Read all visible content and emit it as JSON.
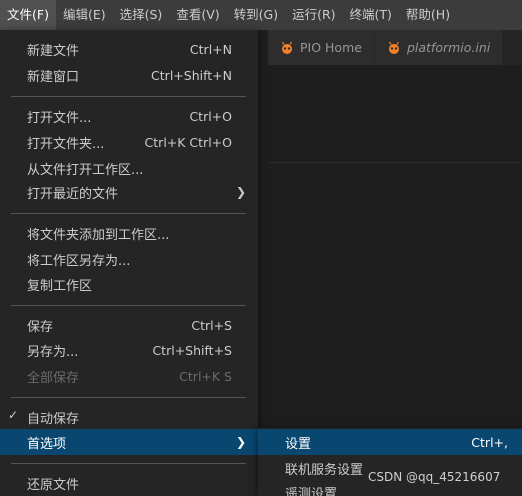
{
  "menubar": {
    "items": [
      "文件(F)",
      "编辑(E)",
      "选择(S)",
      "查看(V)",
      "转到(G)",
      "运行(R)",
      "终端(T)",
      "帮助(H)"
    ]
  },
  "tabs": [
    {
      "label": "PIO Home",
      "icon": "platformio-ant-icon"
    },
    {
      "label": "platformio.ini",
      "icon": "platformio-ant-icon"
    }
  ],
  "file_menu": {
    "new_file": {
      "label": "新建文件",
      "shortcut": "Ctrl+N"
    },
    "new_window": {
      "label": "新建窗口",
      "shortcut": "Ctrl+Shift+N"
    },
    "open_file": {
      "label": "打开文件...",
      "shortcut": "Ctrl+O"
    },
    "open_folder": {
      "label": "打开文件夹...",
      "shortcut": "Ctrl+K Ctrl+O"
    },
    "open_workspace": {
      "label": "从文件打开工作区..."
    },
    "open_recent": {
      "label": "打开最近的文件"
    },
    "add_folder": {
      "label": "将文件夹添加到工作区..."
    },
    "save_workspace_as": {
      "label": "将工作区另存为..."
    },
    "duplicate_workspace": {
      "label": "复制工作区"
    },
    "save": {
      "label": "保存",
      "shortcut": "Ctrl+S"
    },
    "save_as": {
      "label": "另存为...",
      "shortcut": "Ctrl+Shift+S"
    },
    "save_all": {
      "label": "全部保存",
      "shortcut": "Ctrl+K S"
    },
    "auto_save": {
      "label": "自动保存",
      "checked": true
    },
    "preferences": {
      "label": "首选项"
    },
    "revert": {
      "label": "还原文件"
    }
  },
  "submenu": {
    "settings": {
      "label": "设置",
      "shortcut": "Ctrl+,"
    },
    "online_services": {
      "label": "联机服务设置"
    },
    "telemetry": {
      "label": "遥测设置"
    }
  },
  "watermark": "CSDN @qq_45216607",
  "colors": {
    "menubar_bg": "#3c3c3c",
    "menu_bg": "#252526",
    "selection": "#094771",
    "platformio_orange": "#f5822a"
  }
}
